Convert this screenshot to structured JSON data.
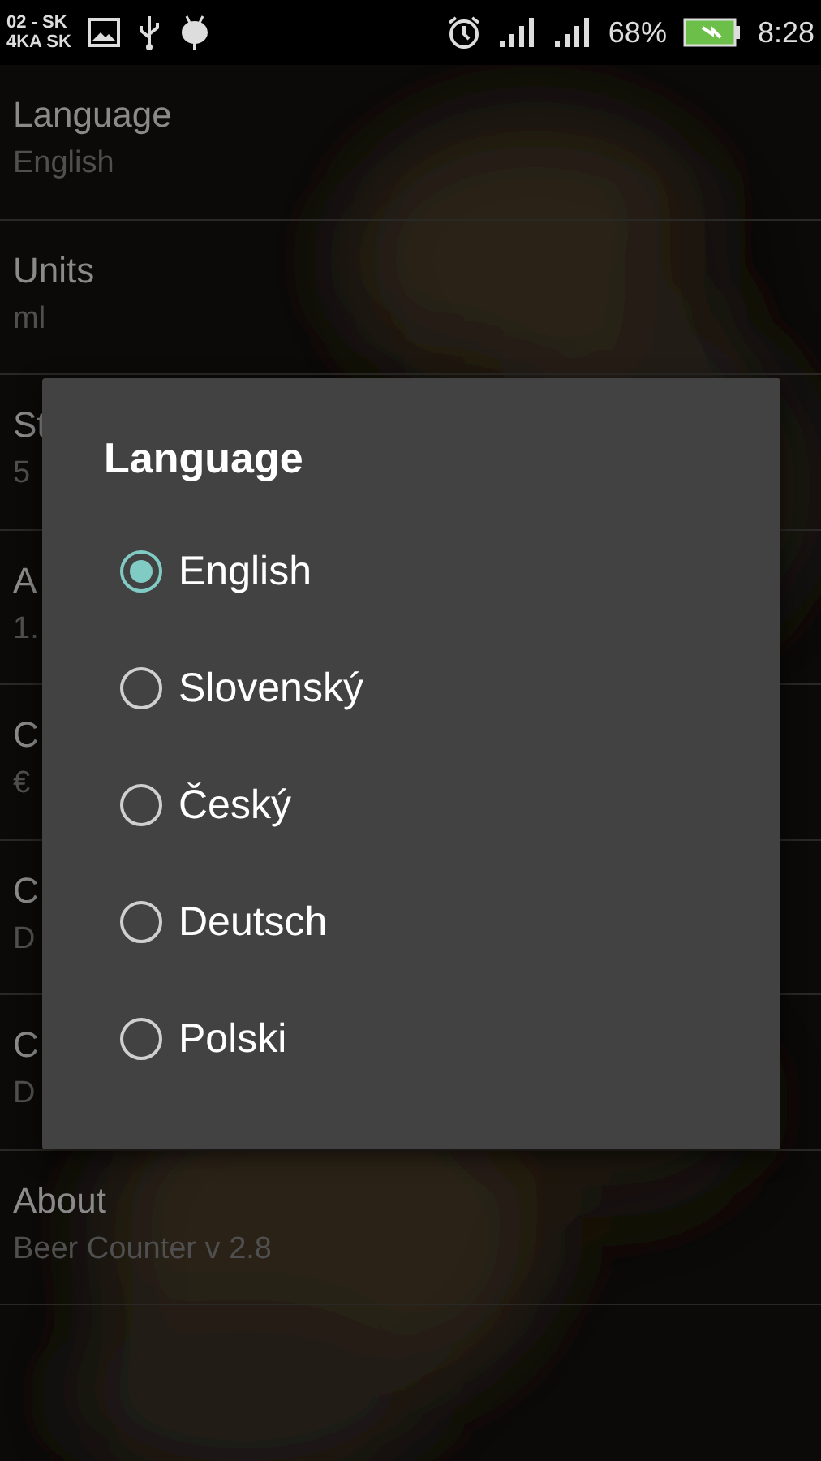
{
  "status_bar": {
    "carrier_line_1": "02 - SK",
    "carrier_line_2": "4KA SK",
    "battery_percent": "68%",
    "time": "8:28"
  },
  "preferences": [
    {
      "title": "Language",
      "summary": "English"
    },
    {
      "title": "Units",
      "summary": "ml"
    },
    {
      "title": "St",
      "summary": "5"
    },
    {
      "title": "A",
      "summary": "1."
    },
    {
      "title": "C",
      "summary": "€"
    },
    {
      "title": "C",
      "summary": "D"
    },
    {
      "title": "C",
      "summary": "D"
    },
    {
      "title": "About",
      "summary": "Beer Counter v 2.8"
    }
  ],
  "dialog": {
    "title": "Language",
    "options": [
      {
        "label": "English",
        "selected": true
      },
      {
        "label": "Slovenský",
        "selected": false
      },
      {
        "label": "Český",
        "selected": false
      },
      {
        "label": "Deutsch",
        "selected": false
      },
      {
        "label": "Polski",
        "selected": false
      }
    ]
  }
}
